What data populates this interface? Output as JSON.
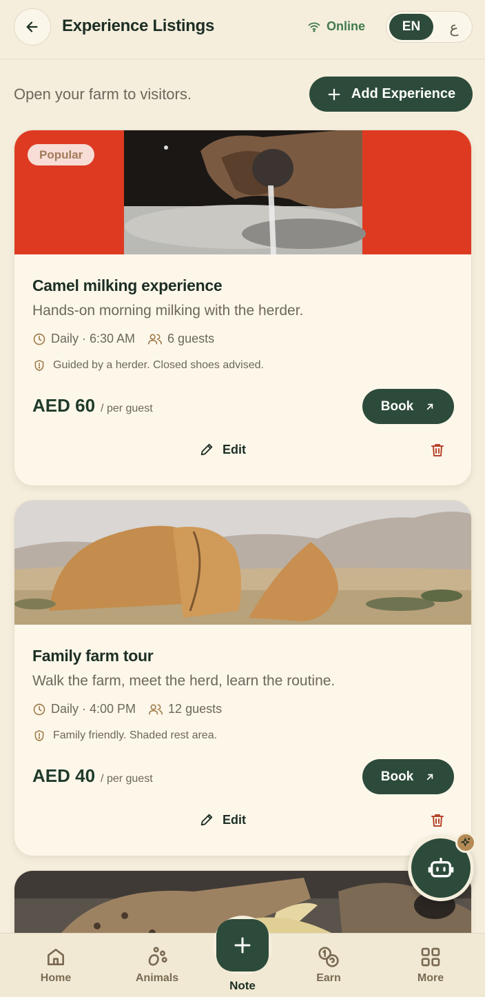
{
  "header": {
    "title": "Experience Listings",
    "status": "Online",
    "lang_en": "EN",
    "lang_ar": "ع"
  },
  "intro": {
    "text": "Open your farm to visitors.",
    "add_label": "Add Experience"
  },
  "listings": [
    {
      "badge": "Popular",
      "image_desc": "camel-milking-photo",
      "title": "Camel milking experience",
      "subtitle": "Hands-on morning milking with the herder.",
      "schedule": "Daily · 6:30 AM",
      "guests": "6 guests",
      "note": "Guided by a herder. Closed shoes advised.",
      "price": "AED 60",
      "price_unit": "/ per guest",
      "book_label": "Book",
      "edit_label": "Edit"
    },
    {
      "image_desc": "desert-rocks-photo",
      "title": "Family farm tour",
      "subtitle": "Walk the farm, meet the herd, learn the routine.",
      "schedule": "Daily · 4:00 PM",
      "guests": "12 guests",
      "note": "Family friendly. Shaded rest area.",
      "price": "AED 40",
      "price_unit": "/ per guest",
      "book_label": "Book",
      "edit_label": "Edit"
    },
    {
      "image_desc": "hyena-photo"
    }
  ],
  "bottom_nav": {
    "home": "Home",
    "animals": "Animals",
    "note": "Note",
    "earn": "Earn",
    "more": "More"
  },
  "colors": {
    "primary": "#2d4b3a",
    "background": "#f5eedd",
    "card": "#fdf7ea",
    "accent_brown": "#b48a55",
    "delete_red": "#b5442a"
  }
}
